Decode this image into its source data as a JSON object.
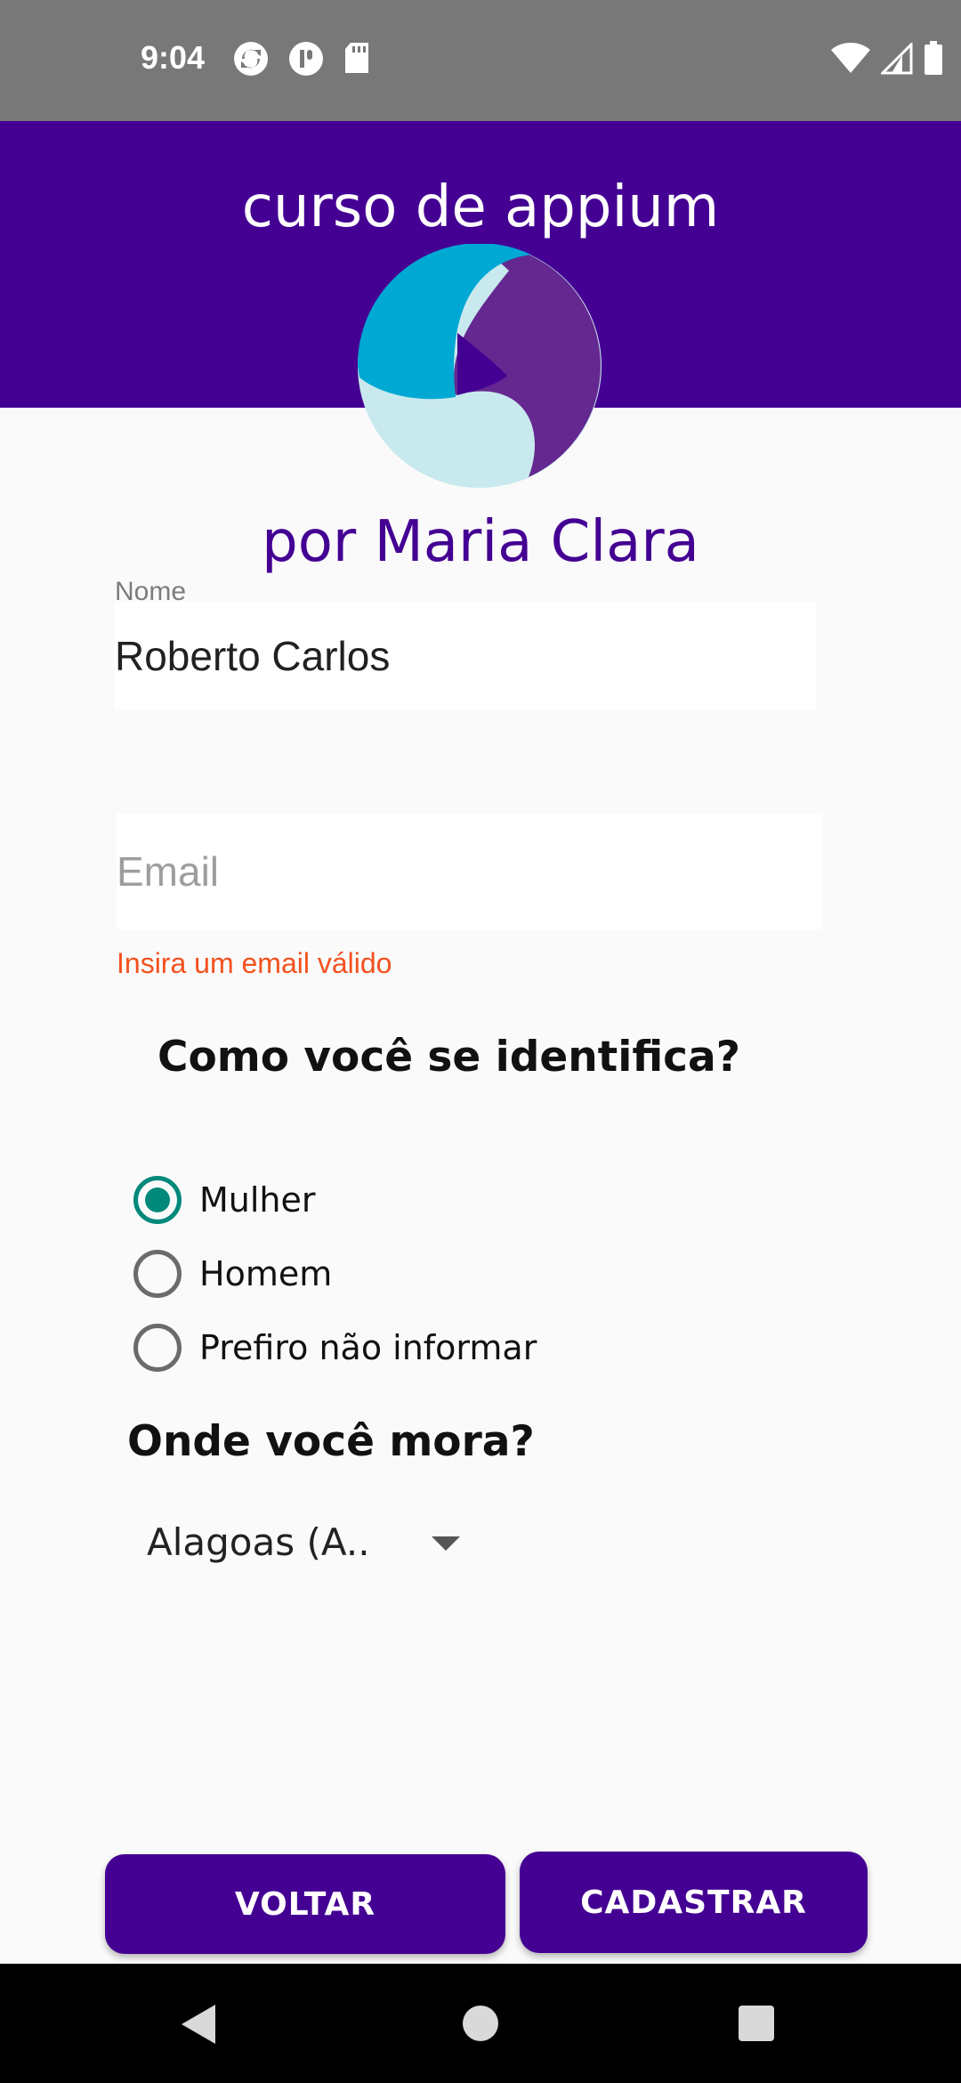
{
  "status_bar": {
    "time": "9:04",
    "icons_left": [
      "sync-icon",
      "app-notification-icon",
      "sd-card-icon"
    ],
    "icons_right": [
      "wifi-icon",
      "signal-icon",
      "battery-icon"
    ]
  },
  "header": {
    "title": "curso de appium",
    "logo": "appium-logo",
    "subtitle": "por Maria Clara"
  },
  "form": {
    "name": {
      "label": "Nome",
      "value": "Roberto Carlos"
    },
    "email": {
      "placeholder": "Email",
      "value": "",
      "error": "Insira um email válido"
    },
    "gender": {
      "question": "Como você se identifica?",
      "options": [
        {
          "label": "Mulher",
          "checked": true
        },
        {
          "label": "Homem",
          "checked": false
        },
        {
          "label": "Prefiro não informar",
          "checked": false
        }
      ]
    },
    "location": {
      "question": "Onde você mora?",
      "selected": "Alagoas (A.."
    }
  },
  "buttons": {
    "back": "VOLTAR",
    "submit": "CADASTRAR"
  },
  "colors": {
    "primary": "#440093",
    "accent": "#00897b",
    "error": "#f4511e",
    "logo_blue": "#00a8d4",
    "logo_purple": "#642890",
    "logo_light": "#c8e9ee"
  }
}
